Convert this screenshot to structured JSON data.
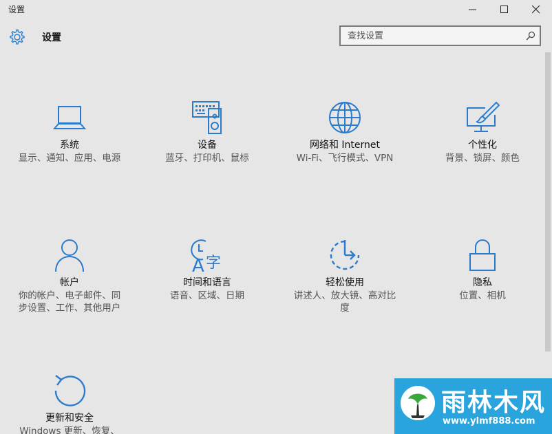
{
  "window": {
    "title": "设置",
    "minimize_icon": "minimize-icon",
    "maximize_icon": "maximize-icon",
    "close_icon": "close-icon"
  },
  "header": {
    "icon": "gear-icon",
    "title": "设置"
  },
  "search": {
    "placeholder": "查找设置",
    "value": "",
    "icon": "search-icon"
  },
  "colors": {
    "accent": "#2b7bcc",
    "background": "#e6e6e6",
    "title_text": "#111111",
    "description_text": "#555555"
  },
  "tiles": [
    {
      "icon": "laptop-icon",
      "title": "系统",
      "desc": "显示、通知、应用、电源"
    },
    {
      "icon": "keyboard-speaker-icon",
      "title": "设备",
      "desc": "蓝牙、打印机、鼠标"
    },
    {
      "icon": "globe-icon",
      "title": "网络和 Internet",
      "desc": "Wi-Fi、飞行模式、VPN"
    },
    {
      "icon": "monitor-brush-icon",
      "title": "个性化",
      "desc": "背景、锁屏、颜色"
    },
    {
      "icon": "person-icon",
      "title": "帐户",
      "desc": "你的帐户、电子邮件、同步设置、工作、其他用户"
    },
    {
      "icon": "clock-language-icon",
      "title": "时间和语言",
      "desc": "语音、区域、日期"
    },
    {
      "icon": "ease-of-access-timer-icon",
      "title": "轻松使用",
      "desc": "讲述人、放大镜、高对比度"
    },
    {
      "icon": "lock-icon",
      "title": "隐私",
      "desc": "位置、相机"
    },
    {
      "icon": "refresh-icon",
      "title": "更新和安全",
      "desc": "Windows 更新、恢复、备份"
    }
  ],
  "watermark": {
    "logo_icon": "tree-logo-icon",
    "name": "雨林木风",
    "url": "www.ylmf888.com"
  }
}
